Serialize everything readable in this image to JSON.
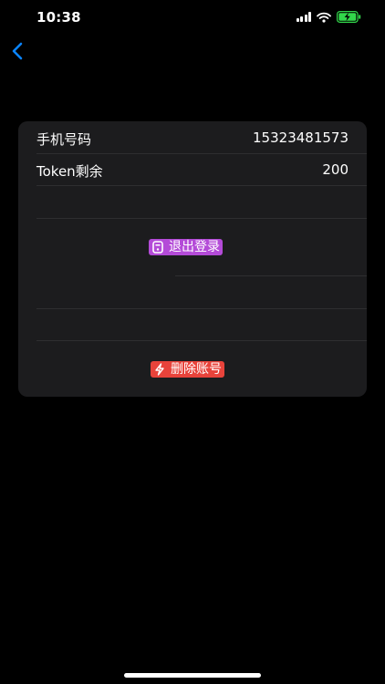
{
  "status_bar": {
    "time": "10:38"
  },
  "account": {
    "phone_label": "手机号码",
    "phone_value": "15323481573",
    "token_label": "Token剩余",
    "token_value": "200"
  },
  "actions": {
    "logout_label": "退出登录",
    "delete_label": "删除账号"
  },
  "icons": {
    "back": "chevron-left-icon",
    "logout": "door-icon",
    "delete": "lightning-icon"
  },
  "colors": {
    "accent": "#0a84ff",
    "logout_button": "#b44bd8",
    "delete_button": "#e8433b",
    "battery": "#32d74b"
  }
}
